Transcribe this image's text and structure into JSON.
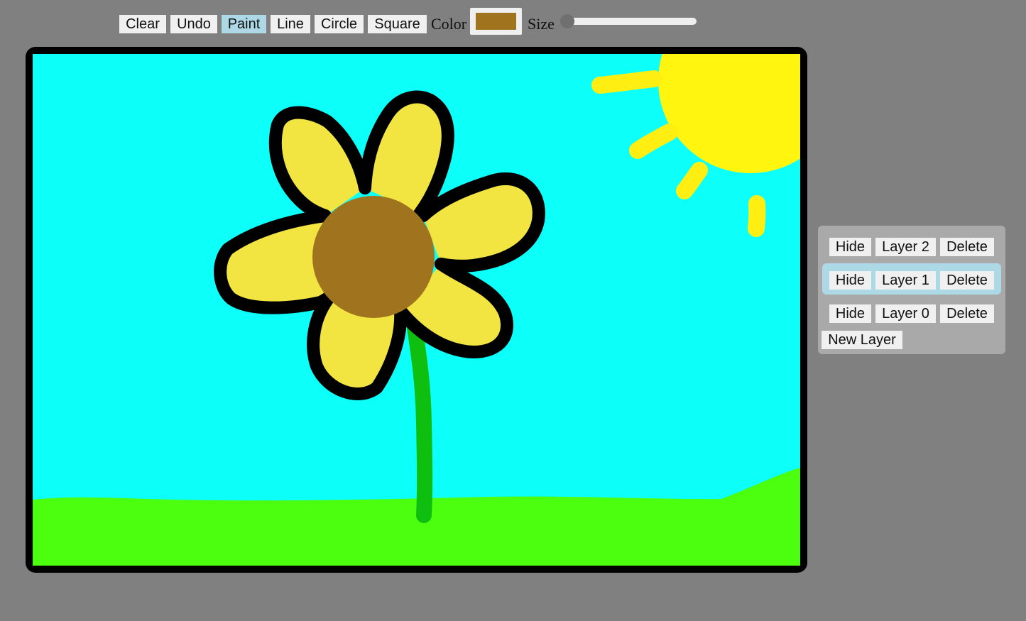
{
  "toolbar": {
    "buttons": [
      {
        "label": "Clear"
      },
      {
        "label": "Undo"
      },
      {
        "label": "Paint",
        "active": true
      },
      {
        "label": "Line"
      },
      {
        "label": "Circle"
      },
      {
        "label": "Square"
      }
    ],
    "color_label": "Color",
    "color_value": "#a0741e",
    "size_label": "Size",
    "size_value_fraction": 0.0
  },
  "canvas": {
    "background": "#0dfffa",
    "palette": {
      "grass": "#4cff0f",
      "sun": "#fff50f",
      "sun_rays": "#ffee11",
      "petals": "#f2e542",
      "outline": "#000000",
      "flower_center": "#a0741e",
      "stem": "#0fbf0f"
    }
  },
  "layers": {
    "items": [
      {
        "hide_label": "Hide",
        "name": "Layer 2",
        "delete_label": "Delete",
        "selected": false
      },
      {
        "hide_label": "Hide",
        "name": "Layer 1",
        "delete_label": "Delete",
        "selected": true
      },
      {
        "hide_label": "Hide",
        "name": "Layer 0",
        "delete_label": "Delete",
        "selected": false
      }
    ],
    "new_layer_label": "New Layer"
  }
}
